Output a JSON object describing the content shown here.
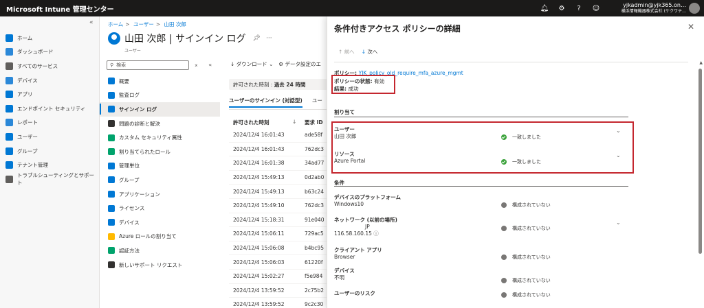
{
  "topbar": {
    "brand": "Microsoft Intune 管理センター",
    "account_line1": "yjkadmin@yjk365.on…",
    "account_line2": "横浜情報機器株式会社 (ケクワテ…"
  },
  "leftnav": {
    "collapse": "«",
    "items": [
      {
        "label": "ホーム",
        "color": "#0078d4"
      },
      {
        "label": "ダッシュボード",
        "color": "#2b88d8"
      },
      {
        "label": "すべてのサービス",
        "color": "#605e5c"
      },
      {
        "label": "デバイス",
        "color": "#2b88d8"
      },
      {
        "label": "アプリ",
        "color": "#0078d4"
      },
      {
        "label": "エンドポイント セキュリティ",
        "color": "#0078d4"
      },
      {
        "label": "レポート",
        "color": "#2b88d8"
      },
      {
        "label": "ユーザー",
        "color": "#0078d4"
      },
      {
        "label": "グループ",
        "color": "#0078d4"
      },
      {
        "label": "テナント管理",
        "color": "#0078d4"
      },
      {
        "label": "トラブルシューティングとサポート",
        "color": "#605e5c"
      }
    ]
  },
  "breadcrumb": [
    "ホーム",
    "ユーザー",
    "山田 次郎"
  ],
  "page": {
    "title": "山田 次郎 | サインイン ログ",
    "subtitle": "ユーザー",
    "search_placeholder": "検索",
    "collapse_btn": "«"
  },
  "menu": [
    {
      "label": "概要",
      "color": "#0078d4"
    },
    {
      "label": "監査ログ",
      "color": "#0078d4"
    },
    {
      "label": "サインイン ログ",
      "color": "#0078d4",
      "active": true
    },
    {
      "label": "問題の診断と解決",
      "color": "#323130"
    },
    {
      "label": "カスタム セキュリティ属性",
      "color": "#00a36c"
    },
    {
      "label": "割り当てられたロール",
      "color": "#00a36c"
    },
    {
      "label": "管理単位",
      "color": "#0078d4"
    },
    {
      "label": "グループ",
      "color": "#0078d4"
    },
    {
      "label": "アプリケーション",
      "color": "#0078d4"
    },
    {
      "label": "ライセンス",
      "color": "#0078d4"
    },
    {
      "label": "デバイス",
      "color": "#0078d4"
    },
    {
      "label": "Azure ロールの割り当て",
      "color": "#ffb900"
    },
    {
      "label": "認証方法",
      "color": "#00a36c"
    },
    {
      "label": "新しいサポート リクエスト",
      "color": "#323130"
    }
  ],
  "toolbar": {
    "download": "ダウンロード",
    "data_settings": "データ設定のエ"
  },
  "time_filter": {
    "label": "許可された時刻 : ",
    "value": "過去 24 時間"
  },
  "tabs": [
    "ユーザーのサインイン (対話型)",
    "ユー"
  ],
  "table": {
    "headers": [
      "許可された時刻",
      "要求 ID"
    ],
    "rows": [
      {
        "time": "2024/12/4 16:01:43",
        "id": "ade58f"
      },
      {
        "time": "2024/12/4 16:01:43",
        "id": "762dc3"
      },
      {
        "time": "2024/12/4 16:01:38",
        "id": "34ad77"
      },
      {
        "time": "2024/12/4 15:49:13",
        "id": "0d2ab0"
      },
      {
        "time": "2024/12/4 15:49:13",
        "id": "b63c24"
      },
      {
        "time": "2024/12/4 15:49:10",
        "id": "762dc3"
      },
      {
        "time": "2024/12/4 15:18:31",
        "id": "91e040"
      },
      {
        "time": "2024/12/4 15:06:11",
        "id": "729ac5"
      },
      {
        "time": "2024/12/4 15:06:08",
        "id": "b4bc95"
      },
      {
        "time": "2024/12/4 15:06:03",
        "id": "61220f"
      },
      {
        "time": "2024/12/4 15:02:27",
        "id": "f5e984"
      },
      {
        "time": "2024/12/4 13:59:52",
        "id": "2c75b2"
      },
      {
        "time": "2024/12/4 13:59:52",
        "id": "9c2c30"
      }
    ]
  },
  "panel": {
    "title": "条件付きアクセス ポリシーの詳細",
    "close": "✕",
    "prev": "前へ",
    "next": "次へ",
    "policy_label": "ポリシー: ",
    "policy_name": "YJK_policy_old_require_mfa_azure_mgmt",
    "state_label": "ポリシーの状態: ",
    "state_value": "有効",
    "result_label": "結果: ",
    "result_value": "成功",
    "assignments_heading": "割り当て",
    "assignments": [
      {
        "label": "ユーザー",
        "value": "山田 次郎",
        "status": "一致しました"
      },
      {
        "label": "リソース",
        "value": "Azure Portal",
        "status": "一致しました"
      }
    ],
    "conditions_heading": "条件",
    "conditions": [
      {
        "label": "デバイスのプラットフォーム",
        "value": "Windows10",
        "status": "構成されていない"
      },
      {
        "label": "ネットワーク (以前の場所)",
        "value": "JP",
        "value2": "116.58.160.15",
        "status": "構成されていない"
      },
      {
        "label": "クライアント アプリ",
        "value": "Browser",
        "status": "構成されていない"
      },
      {
        "label": "デバイス",
        "value": "不明",
        "status": "構成されていない"
      },
      {
        "label": "ユーザーのリスク",
        "value": "",
        "status": "構成されていない"
      }
    ]
  }
}
